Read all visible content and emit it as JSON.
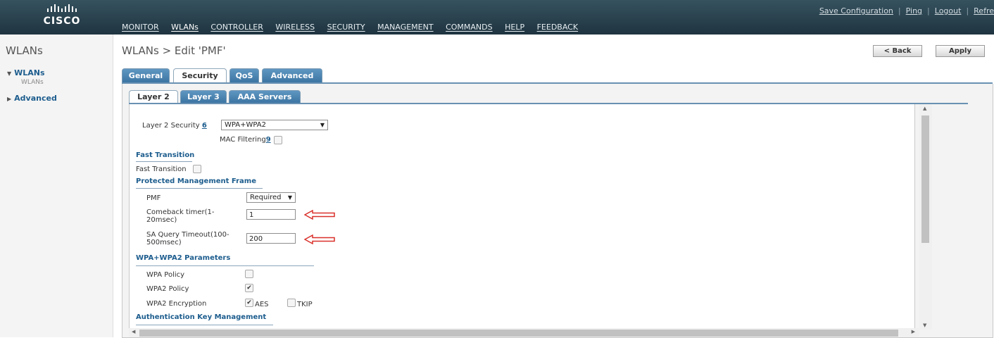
{
  "brand": {
    "name": "CISCO"
  },
  "top_links": [
    "Save Configuration",
    "Ping",
    "Logout",
    "Refre"
  ],
  "menu": [
    "MONITOR",
    "WLANs",
    "CONTROLLER",
    "WIRELESS",
    "SECURITY",
    "MANAGEMENT",
    "COMMANDS",
    "HELP",
    "FEEDBACK"
  ],
  "sidebar": {
    "title": "WLANs",
    "items": [
      {
        "label": "WLANs",
        "sub": "WLANs"
      },
      {
        "label": "Advanced"
      }
    ]
  },
  "page": {
    "title": "WLANs > Edit  'PMF'",
    "back_label": "< Back",
    "apply_label": "Apply"
  },
  "tabs": [
    "General",
    "Security",
    "QoS",
    "Advanced"
  ],
  "subtabs": [
    "Layer 2",
    "Layer 3",
    "AAA Servers"
  ],
  "form": {
    "l2_security_label": "Layer 2 Security",
    "l2_security_help": "6",
    "l2_security_value": "WPA+WPA2",
    "mac_filtering_label": "MAC Filtering",
    "mac_filtering_help": "9",
    "ft_section": "Fast Transition",
    "ft_label": "Fast Transition",
    "pmf_section": "Protected Management Frame",
    "pmf_label": "PMF",
    "pmf_value": "Required",
    "comeback_label_1": "Comeback timer(1-",
    "comeback_label_2": "20msec)",
    "comeback_value": "1",
    "saquery_label_1": "SA Query Timeout(100-",
    "saquery_label_2": "500msec)",
    "saquery_value": "200",
    "wpa_section": "WPA+WPA2 Parameters",
    "wpa_policy_label": "WPA Policy",
    "wpa2_policy_label": "WPA2 Policy",
    "wpa2_enc_label": "WPA2 Encryption",
    "aes_label": "AES",
    "tkip_label": "TKIP",
    "akm_section": "Authentication Key Management"
  },
  "colors": {
    "accent": "#1d5d8e",
    "tab_blue": "#4a82b0",
    "arrow_red": "#d9302a"
  }
}
